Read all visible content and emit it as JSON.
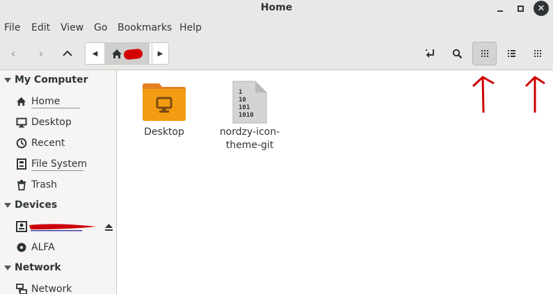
{
  "window": {
    "title": "Home"
  },
  "menu": [
    "File",
    "Edit",
    "View",
    "Go",
    "Bookmarks",
    "Help"
  ],
  "sidebar": {
    "sections": [
      {
        "title": "My Computer",
        "items": [
          "Home",
          "Desktop",
          "Recent",
          "File System",
          "Trash"
        ]
      },
      {
        "title": "Devices",
        "items": [
          "",
          "ALFA"
        ]
      },
      {
        "title": "Network",
        "items": [
          "Network"
        ]
      }
    ]
  },
  "files": [
    {
      "name": "Desktop",
      "type": "folder",
      "icon": "folder-desktop-icon"
    },
    {
      "name_line1": "nordzy-icon-",
      "name_line2": "theme-git",
      "type": "binary",
      "icon": "binary-file-icon",
      "binary_lines": [
        "1",
        "10",
        "101",
        "1010"
      ]
    }
  ],
  "colors": {
    "folder": "#f39c12",
    "folder_dark": "#e67e22",
    "annotation_red": "#cc0000",
    "chrome": "#e8e8e7"
  }
}
